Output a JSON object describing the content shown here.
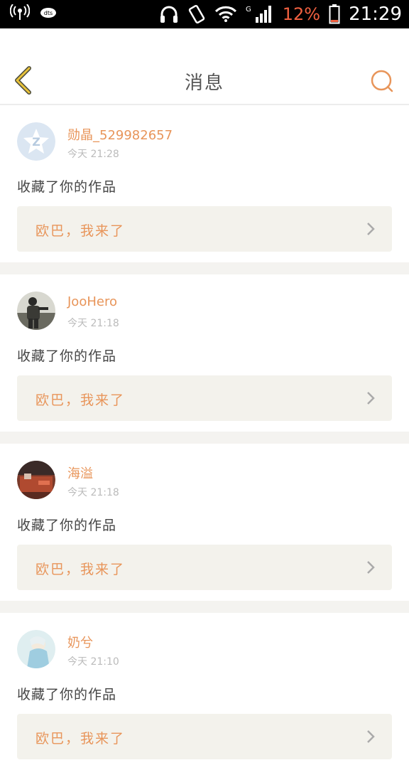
{
  "status_bar": {
    "battery_percent": "12%",
    "time": "21:29",
    "network_type": "G",
    "icons": [
      "hotspot-icon",
      "dts-icon",
      "headphones-icon",
      "vibrate-icon",
      "wifi-icon",
      "signal-icon",
      "battery-icon"
    ]
  },
  "header": {
    "title": "消息",
    "back_icon": "chevron-left-icon",
    "search_icon": "search-icon"
  },
  "messages": [
    {
      "username": "勋晶_529982657",
      "time": "今天 21:28",
      "action": "收藏了你的作品",
      "work_title": "欧巴，我来了",
      "avatar": "default-avatar"
    },
    {
      "username": "JooHero",
      "time": "今天 21:18",
      "action": "收藏了你的作品",
      "work_title": "欧巴，我来了",
      "avatar": "photo-avatar"
    },
    {
      "username": "海溢",
      "time": "今天 21:18",
      "action": "收藏了你的作品",
      "work_title": "欧巴，我来了",
      "avatar": "photo-avatar"
    },
    {
      "username": "奶兮",
      "time": "今天 21:10",
      "action": "收藏了你的作品",
      "work_title": "欧巴，我来了",
      "avatar": "photo-avatar"
    }
  ],
  "colors": {
    "accent": "#e8955a",
    "back_arrow": "#e8c23a",
    "separator": "#f4f3f0",
    "card_bg": "#f3f2ec"
  }
}
